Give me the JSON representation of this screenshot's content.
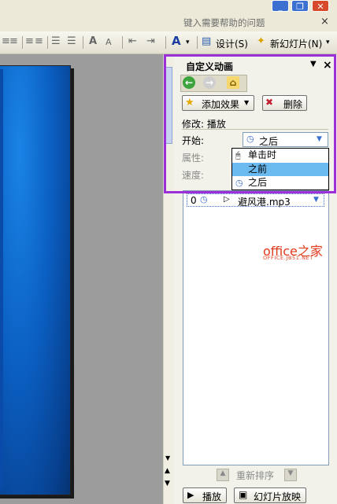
{
  "help_search": {
    "placeholder": "键入需要帮助的问题",
    "close": "×"
  },
  "window_buttons": [
    "_",
    "❐",
    "✕"
  ],
  "toolbar": {
    "design_label": "设计(S)",
    "new_slide_label": "新幻灯片(N)",
    "font_color_glyph": "A"
  },
  "task_pane": {
    "title": "自定义动画",
    "dropdown_glyph": "▼",
    "close_glyph": "×",
    "add_effect_label": "添加效果",
    "delete_label": "删除",
    "modify_label": "修改: 播放",
    "start_label": "开始:",
    "start_value": "之后",
    "property_label": "属性:",
    "speed_label": "速度:",
    "start_options": [
      "单击时",
      "之前",
      "之后"
    ],
    "effect_item": {
      "index": "0",
      "name": "避风港.mp3"
    },
    "reorder_label": "重新排序",
    "play_label": "播放",
    "slideshow_label": "幻灯片放映"
  },
  "watermark": {
    "main": "office之家",
    "sub": "OFFICE.JB51.NET"
  },
  "colors": {
    "highlight": "#9b2fd8",
    "selection": "#6ab9ef",
    "slide": "#0b5fc2"
  }
}
